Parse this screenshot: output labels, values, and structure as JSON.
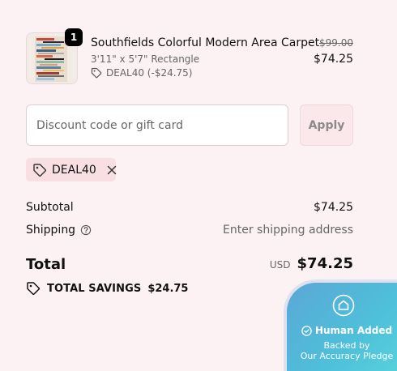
{
  "product": {
    "quantity": "1",
    "title": "Southfields Colorful Modern Area Carpet",
    "variant": "3'11\" x 5'7\" Rectangle",
    "discount_line": "DEAL40 (-$24.75)",
    "original_price": "$99.00",
    "price": "$74.25",
    "image_icon": "carpet-thumbnail"
  },
  "discount": {
    "placeholder": "Discount code or gift card",
    "value": "",
    "apply_label": "Apply"
  },
  "applied_code": {
    "code": "DEAL40",
    "tag_icon": "tag-icon",
    "remove_icon": "close-icon"
  },
  "summary": {
    "subtotal_label": "Subtotal",
    "subtotal_value": "$74.25",
    "shipping_label": "Shipping",
    "shipping_help_icon": "help-circle-icon",
    "shipping_value": "Enter shipping address",
    "total_label": "Total",
    "currency": "USD",
    "total_value": "$74.25",
    "savings_label": "TOTAL SAVINGS",
    "savings_value": "$24.75"
  },
  "badge": {
    "icon": "home-icon",
    "check_icon": "check-circle-icon",
    "title": "Human Added",
    "line1": "Backed by",
    "line2": "Our Accuracy Pledge"
  },
  "colors": {
    "background": "#fdf2f3",
    "apply_button_bg": "#fbe8ea",
    "chip_bg": "#f8dfe2",
    "badge_gradient_start": "#5aa7d6",
    "badge_gradient_end": "#5ad6dc"
  }
}
